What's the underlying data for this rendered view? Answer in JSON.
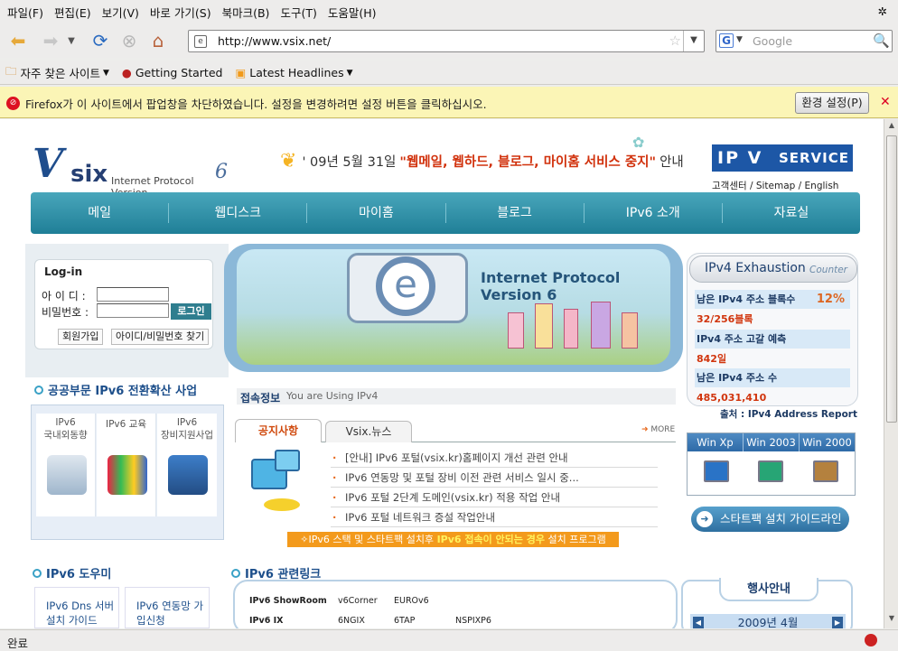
{
  "menu": [
    "파일(F)",
    "편집(E)",
    "보기(V)",
    "바로 가기(S)",
    "북마크(B)",
    "도구(T)",
    "도움말(H)"
  ],
  "url": "http://www.vsix.net/",
  "search_placeholder": "Google",
  "bookmarks": [
    "자주 찾은 사이트",
    "Getting Started",
    "Latest Headlines"
  ],
  "notification": {
    "text": "Firefox가 이 사이트에서 팝업창을 차단하였습니다. 설정을 변경하려면 설정 버튼을 클릭하십시오.",
    "button": "환경 설정(P)"
  },
  "status": "완료",
  "page": {
    "logo_text": "Internet Protocol Version",
    "logo_six": "six",
    "logo_v": "V",
    "logo_num": "6",
    "notice_date": "' 09년 5월 31일",
    "notice_highlight": "\"웹메일, 웹하드, 블로그, 마이홈 서비스 중지\"",
    "notice_tail": "안내",
    "service_badge": "IP V",
    "service_badge2": "SERVICE",
    "top_links": "고객센터   /   Sitemap   /   English",
    "nav": [
      "메일",
      "웹디스크",
      "마이홈",
      "블로그",
      "IPv6 소개",
      "자료실"
    ],
    "login": {
      "title": "Log-in",
      "id_label": "아 이 디 :",
      "pw_label": "비밀번호 :",
      "login_button": "로그인",
      "join": "회원가입",
      "find": "아이디/비밀번호 찾기"
    },
    "public_title": "공공부문 IPv6 전환확산 사업",
    "public_cols": [
      {
        "l1": "IPv6",
        "l2": "국내외동향"
      },
      {
        "l1": "IPv6 교육",
        "l2": ""
      },
      {
        "l1": "IPv6",
        "l2": "장비지원사업"
      }
    ],
    "banner_title": "Internet Protocol Version 6",
    "connect_label": "접속정보",
    "connect_value": "You are Using IPv4",
    "tab_notice": "공지사항",
    "tab_news": "Vsix.뉴스",
    "more": "MORE",
    "news": [
      "[안내] IPv6 포털(vsix.kr)홈페이지 개선 관련 안내",
      "IPv6 연동망 및 포털 장비 이전 관련 서비스 일시 중...",
      "IPv6 포털 2단계 도메인(vsix.kr) 적용 작업 안내",
      "IPv6 포털 네트워크 증설 작업안내"
    ],
    "orange_pre": "IPv6 스택 및 스타트팩 설치후",
    "orange_hl": "IPv6 접속이 안되는 경우",
    "orange_post": "설치 프로그램",
    "exhaustion": {
      "title": "IPv4 Exhaustion",
      "counter": "Counter",
      "r1": "남은 IPv4 주소 블록수",
      "r1_pct": "12%",
      "r2": "32/256블록",
      "r3": "IPv4 주소 고갈 예측",
      "r4": "842일",
      "r5": "남은 IPv4 주소 수",
      "r6": "485,031,410"
    },
    "source": "출처 : IPv4 Address Report",
    "win": [
      "Win Xp",
      "Win 2003",
      "Win 2000"
    ],
    "start_guide": "스타트팩 설치 가이드라인",
    "help_title": "IPv6 도우미",
    "help1": "IPv6 Dns 서버 설치 가이드",
    "help2": "IPv6 연동망 가입신청",
    "links_title": "IPv6 관련링크",
    "links": [
      {
        "k": "IPv6 ShowRoom",
        "a": "v6Corner",
        "b": "EUROv6",
        "c": ""
      },
      {
        "k": "IPv6 IX",
        "a": "6NGIX",
        "b": "6TAP",
        "c": "NSPIXP6"
      }
    ],
    "event_title": "행사안내",
    "event_month": "2009년 4월"
  }
}
